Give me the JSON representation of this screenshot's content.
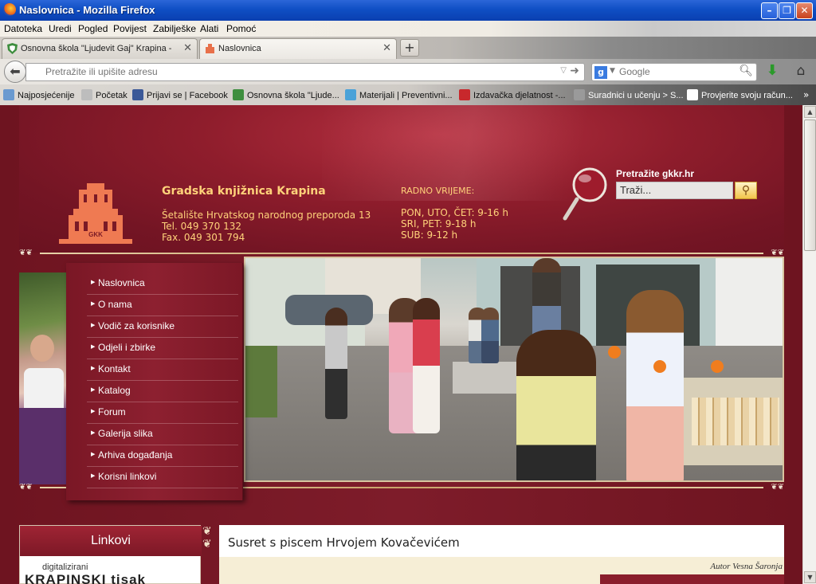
{
  "window": {
    "title": "Naslovnica - Mozilla Firefox"
  },
  "menu": [
    "Datoteka",
    "Uredi",
    "Pogled",
    "Povijest",
    "Zabilješke",
    "Alati",
    "Pomoć"
  ],
  "tabs": [
    {
      "label": "Osnovna škola \"Ljudevit Gaj\" Krapina - N...",
      "active": false
    },
    {
      "label": "Naslovnica",
      "active": true
    }
  ],
  "urlbar": {
    "placeholder": "Pretražite ili upišite adresu"
  },
  "searchbar": {
    "placeholder": "Google"
  },
  "bookmarks": [
    "Najposjećenije",
    "Početak",
    "Prijavi se | Facebook",
    "Osnovna škola \"Ljude...",
    "Materijali | Preventivni...",
    "Izdavačka djelatnost -...",
    "Suradnici u učenju > S...",
    "Provjerite svoju račun..."
  ],
  "site": {
    "name": "Gradska knjižnica Krapina",
    "address": [
      "Šetalište Hrvatskog narodnog preporoda 13",
      "Tel. 049 370 132",
      "Fax. 049 301 794"
    ],
    "hours_title": "RADNO VRIJEME:",
    "hours": [
      "PON, UTO, ČET: 9-16 h",
      "SRI, PET: 9-18 h",
      "SUB: 9-12 h"
    ],
    "search_label": "Pretražite gkkr.hr",
    "search_value": "Traži...",
    "logo_text": "GKK",
    "nav": [
      "Naslovnica",
      "O nama",
      "Vodič za korisnike",
      "Odjeli i zbirke",
      "Kontakt",
      "Katalog",
      "Forum",
      "Galerija slika",
      "Arhiva događanja",
      "Korisni linkovi"
    ],
    "links_title": "Linkovi",
    "links_banner_small": "digitalizirani",
    "links_banner_big": "KRAPINSKI tisak",
    "article_title": "Susret s piscem Hrvojem Kovačevićem",
    "article_author": "Autor Vesna Šaronja"
  },
  "colors": {
    "brand": "#8d2030",
    "gold_text": "#ffd27a",
    "titlebar": "#0f4fc4"
  }
}
